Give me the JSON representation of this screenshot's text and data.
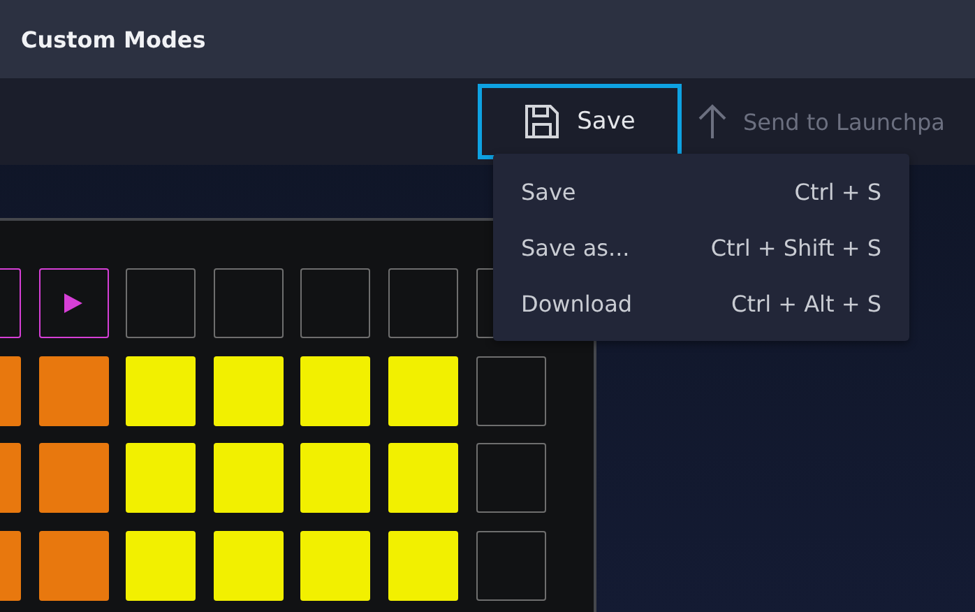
{
  "window": {
    "title": "Custom Modes"
  },
  "toolbar": {
    "save_button": {
      "label": "Save",
      "selected": true
    },
    "send_button": {
      "label": "Send to Launchpa",
      "disabled": true
    }
  },
  "save_menu": {
    "items": [
      {
        "label": "Save",
        "shortcut": "Ctrl + S"
      },
      {
        "label": "Save as...",
        "shortcut": "Ctrl + Shift + S"
      },
      {
        "label": "Download",
        "shortcut": "Ctrl + Alt + S"
      }
    ]
  },
  "pad_grid": {
    "rows": [
      [
        {
          "kind": "outline",
          "color": "#d63fd6"
        },
        {
          "kind": "play",
          "color": "#d63fd6"
        },
        {
          "kind": "outline",
          "color": "#6e6e6e"
        },
        {
          "kind": "outline",
          "color": "#6e6e6e"
        },
        {
          "kind": "outline",
          "color": "#6e6e6e"
        },
        {
          "kind": "outline",
          "color": "#6e6e6e"
        },
        {
          "kind": "outline",
          "color": "#6e6e6e"
        }
      ],
      [
        {
          "kind": "filled",
          "color": "#e8780e"
        },
        {
          "kind": "filled",
          "color": "#e8780e"
        },
        {
          "kind": "filled",
          "color": "#f2f000"
        },
        {
          "kind": "filled",
          "color": "#f2f000"
        },
        {
          "kind": "filled",
          "color": "#f2f000"
        },
        {
          "kind": "filled",
          "color": "#f2f000"
        },
        {
          "kind": "outline",
          "color": "#6e6e6e"
        }
      ],
      [
        {
          "kind": "filled",
          "color": "#e8780e"
        },
        {
          "kind": "filled",
          "color": "#e8780e"
        },
        {
          "kind": "filled",
          "color": "#f2f000"
        },
        {
          "kind": "filled",
          "color": "#f2f000"
        },
        {
          "kind": "filled",
          "color": "#f2f000"
        },
        {
          "kind": "filled",
          "color": "#f2f000"
        },
        {
          "kind": "outline",
          "color": "#6e6e6e"
        }
      ],
      [
        {
          "kind": "filled",
          "color": "#e8780e"
        },
        {
          "kind": "filled",
          "color": "#e8780e"
        },
        {
          "kind": "filled",
          "color": "#f2f000"
        },
        {
          "kind": "filled",
          "color": "#f2f000"
        },
        {
          "kind": "filled",
          "color": "#f2f000"
        },
        {
          "kind": "filled",
          "color": "#f2f000"
        },
        {
          "kind": "outline",
          "color": "#6e6e6e"
        }
      ]
    ]
  }
}
